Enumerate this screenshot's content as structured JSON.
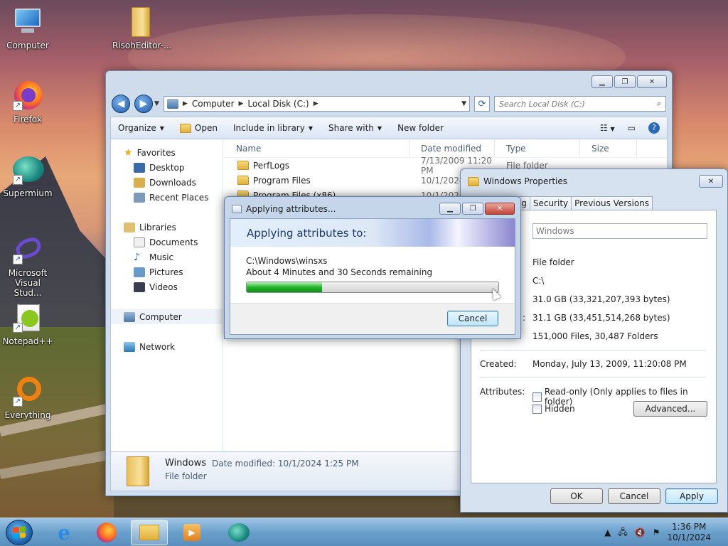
{
  "desktop": {
    "icons": [
      {
        "label": "Computer"
      },
      {
        "label": "RisohEditor-..."
      },
      {
        "label": "Firefox"
      },
      {
        "label": "Supermium"
      },
      {
        "label": "Microsoft Visual Stud..."
      },
      {
        "label": "Notepad++"
      },
      {
        "label": "Everything"
      }
    ]
  },
  "explorer": {
    "breadcrumb": [
      "Computer",
      "Local Disk (C:)"
    ],
    "search_placeholder": "Search Local Disk (C:)",
    "toolbar": {
      "organize": "Organize",
      "open": "Open",
      "include_in_library": "Include in library",
      "share_with": "Share with",
      "new_folder": "New folder"
    },
    "nav": {
      "favorites": "Favorites",
      "favorites_items": [
        "Desktop",
        "Downloads",
        "Recent Places"
      ],
      "libraries": "Libraries",
      "libraries_items": [
        "Documents",
        "Music",
        "Pictures",
        "Videos"
      ],
      "computer": "Computer",
      "network": "Network"
    },
    "columns": {
      "name": "Name",
      "date": "Date modified",
      "type": "Type",
      "size": "Size"
    },
    "rows": [
      {
        "name": "PerfLogs",
        "date": "7/13/2009 11:20 PM",
        "type": "File folder"
      },
      {
        "name": "Program Files",
        "date": "10/1/2024",
        "type": ""
      },
      {
        "name": "Program Files (x86)",
        "date": "10/1/2024",
        "type": ""
      }
    ],
    "details": {
      "name": "Windows",
      "modified": "Date modified: 10/1/2024 1:25 PM",
      "type": "File folder"
    }
  },
  "properties": {
    "title": "Windows Properties",
    "tabs": [
      "aring",
      "Security",
      "Previous Versions"
    ],
    "name_value": "Windows",
    "type_value": "File folder",
    "location_value": "C:\\",
    "size_value": "31.0 GB (33,321,207,393 bytes)",
    "size_on_disk_value": "31.1 GB (33,451,514,268 bytes)",
    "size_on_disk_label_fragment": ":",
    "contains_value": "151,000 Files, 30,487 Folders",
    "created_label": "Created:",
    "created_value": "Monday, July 13, 2009, 11:20:08 PM",
    "attributes_label": "Attributes:",
    "readonly_label": "Read-only (Only applies to files in folder)",
    "hidden_label": "Hidden",
    "advanced_button": "Advanced...",
    "ok_button": "OK",
    "cancel_button": "Cancel",
    "apply_button": "Apply"
  },
  "apply_dialog": {
    "title": "Applying attributes...",
    "heading": "Applying attributes to:",
    "path": "C:\\Windows\\winsxs",
    "remaining": "About 4 Minutes and 30 Seconds remaining",
    "progress": 0.3,
    "cancel": "Cancel"
  },
  "taskbar": {
    "time": "1:36 PM",
    "date": "10/1/2024"
  },
  "colors": {
    "accent": "#1b5aa8",
    "progress_green": "#22b52a",
    "taskbar": "#6aa0cc"
  }
}
